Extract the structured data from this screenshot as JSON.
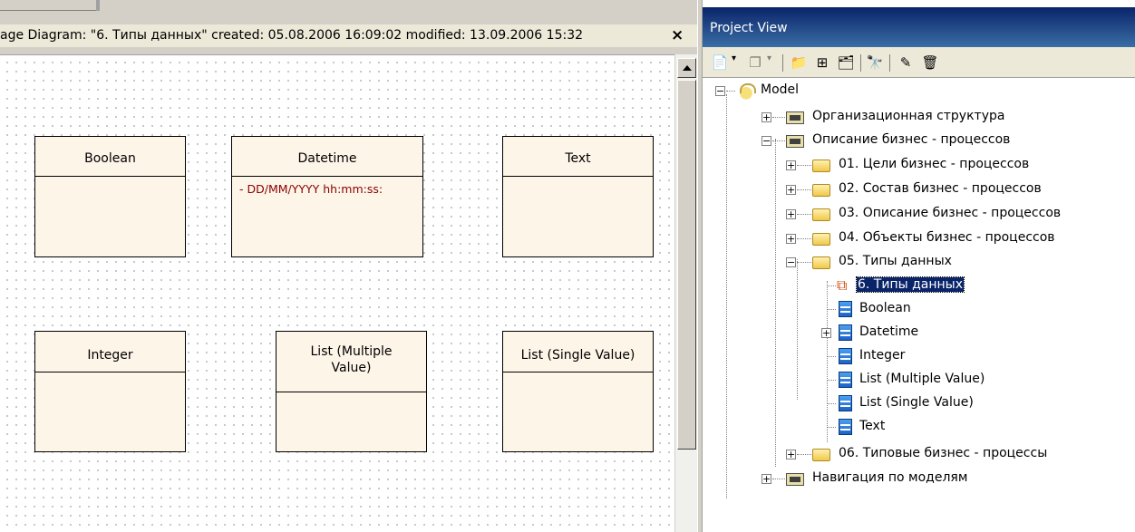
{
  "diagram": {
    "title": "age Diagram: \"6. Типы данных\"  created: 05.08.2006 16:09:02  modified: 13.09.2006 15:32",
    "close_label": "×",
    "classes": [
      {
        "name": "Boolean",
        "attributes": []
      },
      {
        "name": "Datetime",
        "attributes": [
          "-    DD/MM/YYYY hh:mm:ss:"
        ]
      },
      {
        "name": "Text",
        "attributes": []
      },
      {
        "name": "Integer",
        "attributes": []
      },
      {
        "name": "List (Multiple\nValue)",
        "attributes": []
      },
      {
        "name": "List (Single Value)",
        "attributes": []
      }
    ]
  },
  "project_view": {
    "title": "Project View",
    "toolbar_icons": [
      "new-element-icon",
      "copy-icon",
      "new-package-icon",
      "new-diagram-icon",
      "package-icon",
      "find-icon",
      "edit-icon",
      "delete-icon"
    ],
    "tree": [
      {
        "label": "Model",
        "icon": "model-icon",
        "expander": "−",
        "level": 0
      },
      {
        "label": "Организационная структура",
        "icon": "package-icon",
        "expander": "+",
        "level": 1
      },
      {
        "label": "Описание бизнес - процессов",
        "icon": "package-icon",
        "expander": "−",
        "level": 1
      },
      {
        "label": "01. Цели бизнес - процессов",
        "icon": "folder-icon",
        "expander": "+",
        "level": 2
      },
      {
        "label": "02. Состав бизнес - процессов",
        "icon": "folder-icon",
        "expander": "+",
        "level": 2
      },
      {
        "label": "03. Описание бизнес - процессов",
        "icon": "folder-icon",
        "expander": "+",
        "level": 2
      },
      {
        "label": "04. Объекты бизнес - процессов",
        "icon": "folder-icon",
        "expander": "+",
        "level": 2
      },
      {
        "label": "05. Типы данных",
        "icon": "folder-icon",
        "expander": "−",
        "level": 2
      },
      {
        "label": "6. Типы данных",
        "icon": "diagram-icon",
        "expander": "",
        "level": 3,
        "selected": true
      },
      {
        "label": "Boolean",
        "icon": "class-icon",
        "expander": "",
        "level": 3
      },
      {
        "label": "Datetime",
        "icon": "class-icon",
        "expander": "+",
        "level": 3
      },
      {
        "label": "Integer",
        "icon": "class-icon",
        "expander": "",
        "level": 3
      },
      {
        "label": "List (Multiple Value)",
        "icon": "class-icon",
        "expander": "",
        "level": 3
      },
      {
        "label": "List (Single Value)",
        "icon": "class-icon",
        "expander": "",
        "level": 3
      },
      {
        "label": "Text",
        "icon": "class-icon",
        "expander": "",
        "level": 3
      },
      {
        "label": "06. Типовые бизнес - процессы",
        "icon": "folder-icon",
        "expander": "+",
        "level": 2
      },
      {
        "label": "Навигация по моделям",
        "icon": "package-icon",
        "expander": "+",
        "level": 1
      }
    ]
  }
}
